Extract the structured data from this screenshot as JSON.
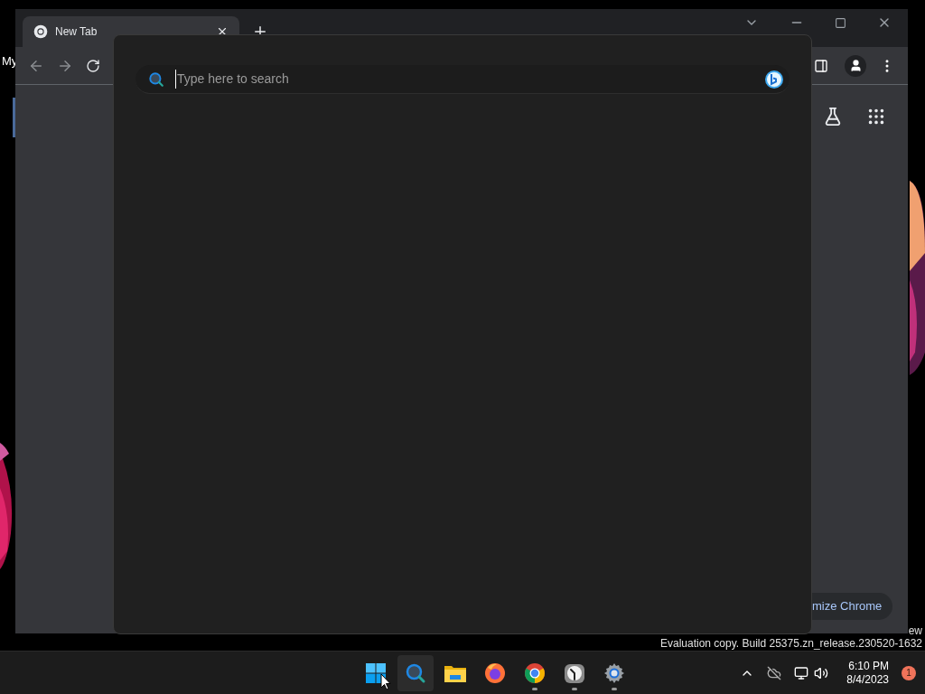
{
  "desktop": {
    "icon_label": "My",
    "watermark_lines": [
      "ew",
      "Evaluation copy. Build 25375.zn_release.230520-1632"
    ]
  },
  "browser": {
    "tabs": [
      {
        "title": "New Tab",
        "selected": true
      }
    ],
    "customize_button": "mize Chrome"
  },
  "search_panel": {
    "placeholder": "Type here to search"
  },
  "taskbar": {
    "apps": [
      {
        "kind": "start",
        "selected": false,
        "running": false
      },
      {
        "kind": "search",
        "selected": true,
        "running": false
      },
      {
        "kind": "files",
        "selected": false,
        "running": false
      },
      {
        "kind": "firefox",
        "selected": false,
        "running": false
      },
      {
        "kind": "chrome",
        "selected": false,
        "running": true
      },
      {
        "kind": "clock",
        "selected": false,
        "running": true
      },
      {
        "kind": "settings",
        "selected": false,
        "running": true
      }
    ],
    "time": "6:10 PM",
    "date": "8/4/2023",
    "notifications": "1"
  }
}
